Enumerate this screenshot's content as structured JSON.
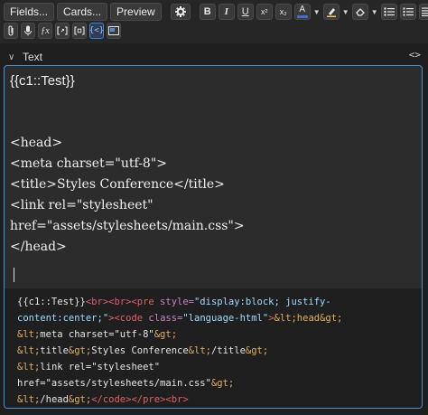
{
  "toolbar": {
    "fields_label": "Fields...",
    "cards_label": "Cards...",
    "preview_label": "Preview",
    "bold": "B",
    "italic": "I",
    "underline": "U",
    "superscript": "x²",
    "subscript": "x₂",
    "text_color": "A",
    "text_color_value": "#3b6fd4",
    "highlight_color_value": "#f2c94c"
  },
  "field": {
    "label": "Text",
    "toggle": "<>"
  },
  "editor": {
    "rich": {
      "title": "{{c1::Test}}",
      "lines": [
        "<head>",
        "<meta charset=\"utf-8\">",
        "<title>Styles Conference</title>",
        "<link rel=\"stylesheet\"",
        "href=\"assets/stylesheets/main.css\">",
        "</head>"
      ]
    },
    "html": {
      "l1a": "{{c1::Test}}",
      "l1b": "<br><br><pre ",
      "l1c": "style=",
      "l1d": "\"display:block; justify-",
      "l2a": "content:center;\"",
      "l2b": "><code ",
      "l2c": "class=",
      "l2d": "\"language-html\"",
      "l2e": ">",
      "l2f": "&lt;head&gt;",
      "l3a": "&lt;",
      "l3b": "meta charset=\"utf-8\"",
      "l3c": "&gt;",
      "l4a": "&lt;",
      "l4b": "title",
      "l4c": "&gt;",
      "l4d": "Styles Conference",
      "l4e": "&lt;",
      "l4f": "/title",
      "l4g": "&gt;",
      "l5a": "&lt;",
      "l5b": "link rel=\"stylesheet\"",
      "l6a": "href=\"assets/stylesheets/main.css\"",
      "l6b": "&gt;",
      "l7a": "&lt;",
      "l7b": "/head",
      "l7c": "&gt;",
      "l7d": "</code></pre><br>"
    }
  },
  "colors": {
    "accent_border": "#4a90d9",
    "tag": "#e06060",
    "attribute": "#c586c0",
    "string": "#9cdcfe",
    "entity": "#e0b060"
  },
  "icons": {
    "settings": "gear-icon",
    "eraser": "eraser-icon",
    "bulleted_list": "bulleted-list-icon",
    "numbered_list": "numbered-list-icon",
    "align": "align-icon",
    "attach": "paperclip-icon",
    "record": "microphone-icon",
    "mathjax": "function-icon",
    "cloze_inline": "cloze-icon",
    "cloze_block": "cloze-block-icon",
    "html_editor": "code-braces-icon",
    "image_occlusion": "image-occlusion-icon"
  }
}
